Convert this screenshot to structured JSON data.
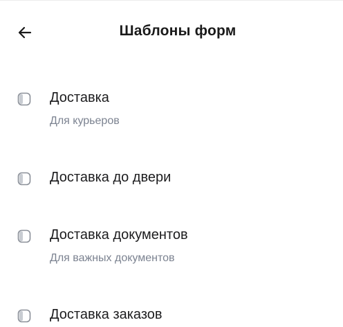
{
  "header": {
    "back_icon": "arrow-left-icon",
    "title": "Шаблоны форм"
  },
  "templates": [
    {
      "label": "Доставка",
      "subtitle": "Для курьеров",
      "icon": "template-icon"
    },
    {
      "label": "Доставка до двери",
      "subtitle": "",
      "icon": "template-icon"
    },
    {
      "label": "Доставка документов",
      "subtitle": "Для важных документов",
      "icon": "template-icon"
    },
    {
      "label": "Доставка заказов",
      "subtitle": "",
      "icon": "template-icon"
    }
  ]
}
